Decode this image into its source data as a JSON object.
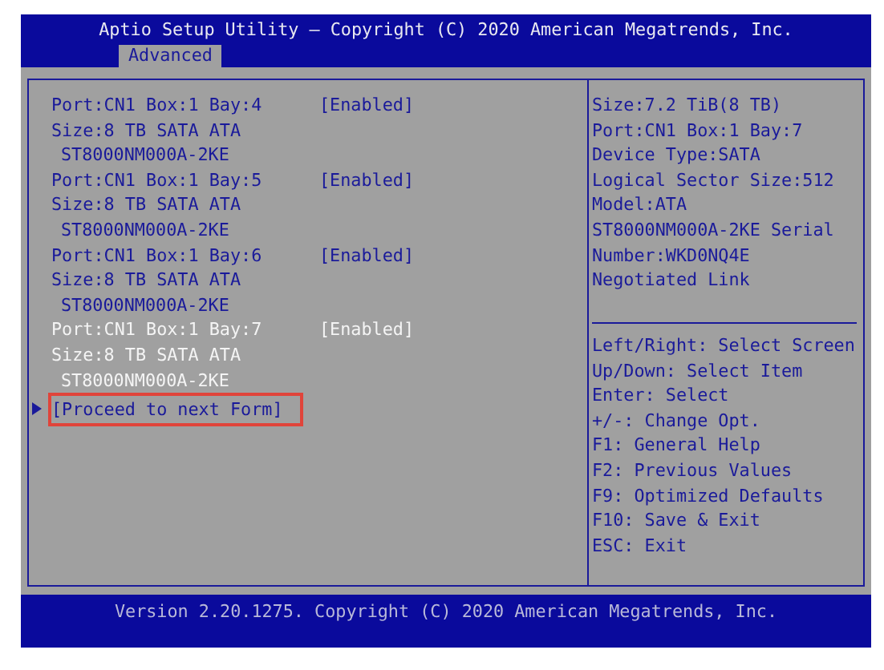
{
  "header": {
    "title": "Aptio Setup Utility – Copyright (C) 2020 American Megatrends, Inc.",
    "tabs": [
      {
        "label": "Advanced",
        "selected": true
      }
    ]
  },
  "devices": [
    {
      "port": "Port:CN1 Box:1 Bay:4",
      "value": "[Enabled]",
      "size": "Size:8 TB SATA ATA",
      "model": "ST8000NM000A-2KE",
      "selected": false
    },
    {
      "port": "Port:CN1 Box:1 Bay:5",
      "value": "[Enabled]",
      "size": "Size:8 TB SATA ATA",
      "model": "ST8000NM000A-2KE",
      "selected": false
    },
    {
      "port": "Port:CN1 Box:1 Bay:6",
      "value": "[Enabled]",
      "size": "Size:8 TB SATA ATA",
      "model": "ST8000NM000A-2KE",
      "selected": false
    },
    {
      "port": "Port:CN1 Box:1 Bay:7",
      "value": "[Enabled]",
      "size": "Size:8 TB SATA ATA",
      "model": "ST8000NM000A-2KE",
      "selected": true
    }
  ],
  "link": {
    "label": "[Proceed to next Form]",
    "highlighted": true
  },
  "description": [
    "Size:7.2 TiB(8 TB)",
    "Port:CN1 Box:1 Bay:7",
    "Device Type:SATA",
    "Logical Sector Size:512",
    "Model:ATA",
    "ST8000NM000A-2KE Serial",
    "Number:WKD0NQ4E",
    "Negotiated Link"
  ],
  "help": [
    "Left/Right: Select Screen",
    "Up/Down: Select Item",
    "Enter: Select",
    "+/-: Change Opt.",
    "F1: General Help",
    "F2: Previous Values",
    "F9: Optimized Defaults",
    "F10: Save & Exit",
    "ESC: Exit"
  ],
  "footer": "Version 2.20.1275. Copyright (C) 2020 American Megatrends, Inc."
}
